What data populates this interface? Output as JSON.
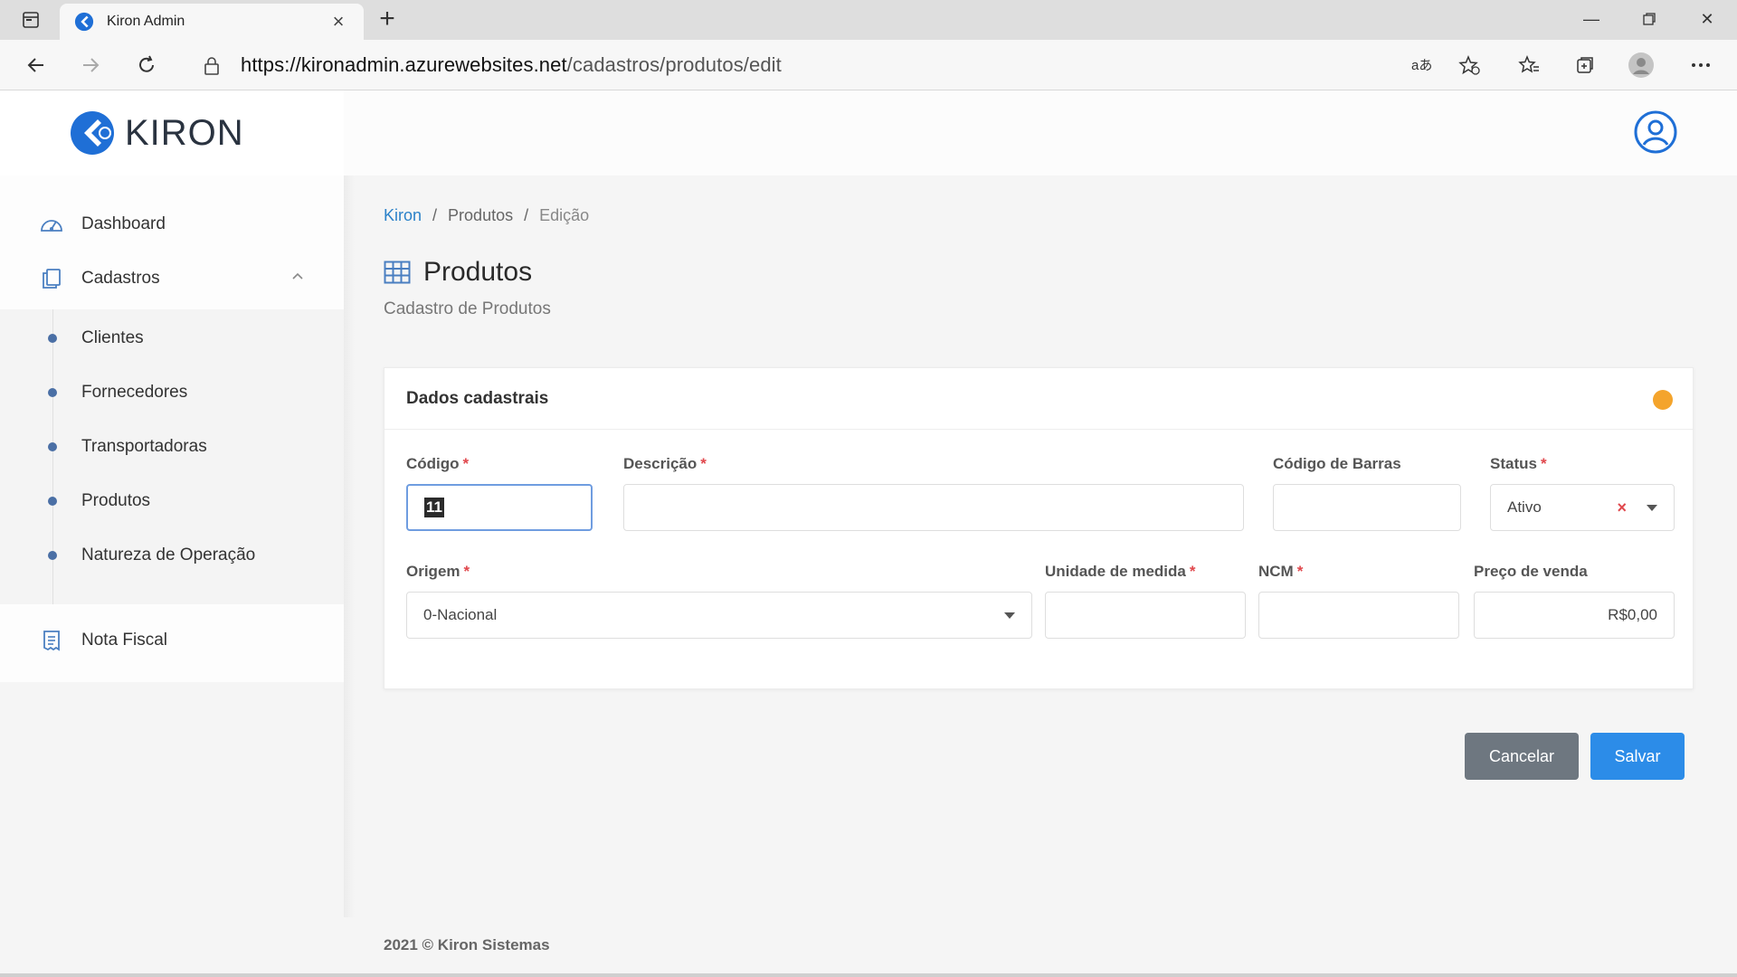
{
  "browser": {
    "tab_title": "Kiron Admin",
    "url_host": "https://kironadmin.azurewebsites.net",
    "url_path": "/cadastros/produtos/edit"
  },
  "app": {
    "logo_text": "KIRON",
    "brand_color": "#1f6fd6"
  },
  "sidebar": {
    "dashboard": "Dashboard",
    "cadastros": "Cadastros",
    "sub_items": [
      "Clientes",
      "Fornecedores",
      "Transportadoras",
      "Produtos",
      "Natureza de Operação"
    ],
    "nota_fiscal": "Nota Fiscal"
  },
  "breadcrumb": {
    "root": "Kiron",
    "sep": "/",
    "section": "Produtos",
    "current": "Edição"
  },
  "page": {
    "title": "Produtos",
    "subtitle": "Cadastro de Produtos"
  },
  "card": {
    "title": "Dados cadastrais",
    "status_color": "#f4a42c"
  },
  "form": {
    "codigo": {
      "label": "Código",
      "required": "*",
      "value": "11"
    },
    "descricao": {
      "label": "Descrição",
      "required": "*",
      "value": ""
    },
    "codigo_barras": {
      "label": "Código de Barras",
      "value": ""
    },
    "status": {
      "label": "Status",
      "required": "*",
      "value": "Ativo",
      "clear": "×"
    },
    "origem": {
      "label": "Origem",
      "required": "*",
      "value": "0-Nacional"
    },
    "unidade": {
      "label": "Unidade de medida",
      "required": "*",
      "value": ""
    },
    "ncm": {
      "label": "NCM",
      "required": "*",
      "value": ""
    },
    "preco": {
      "label": "Preço de venda",
      "value": "R$0,00"
    }
  },
  "actions": {
    "cancel": "Cancelar",
    "save": "Salvar"
  },
  "footer": {
    "text": "2021 © Kiron Sistemas"
  }
}
